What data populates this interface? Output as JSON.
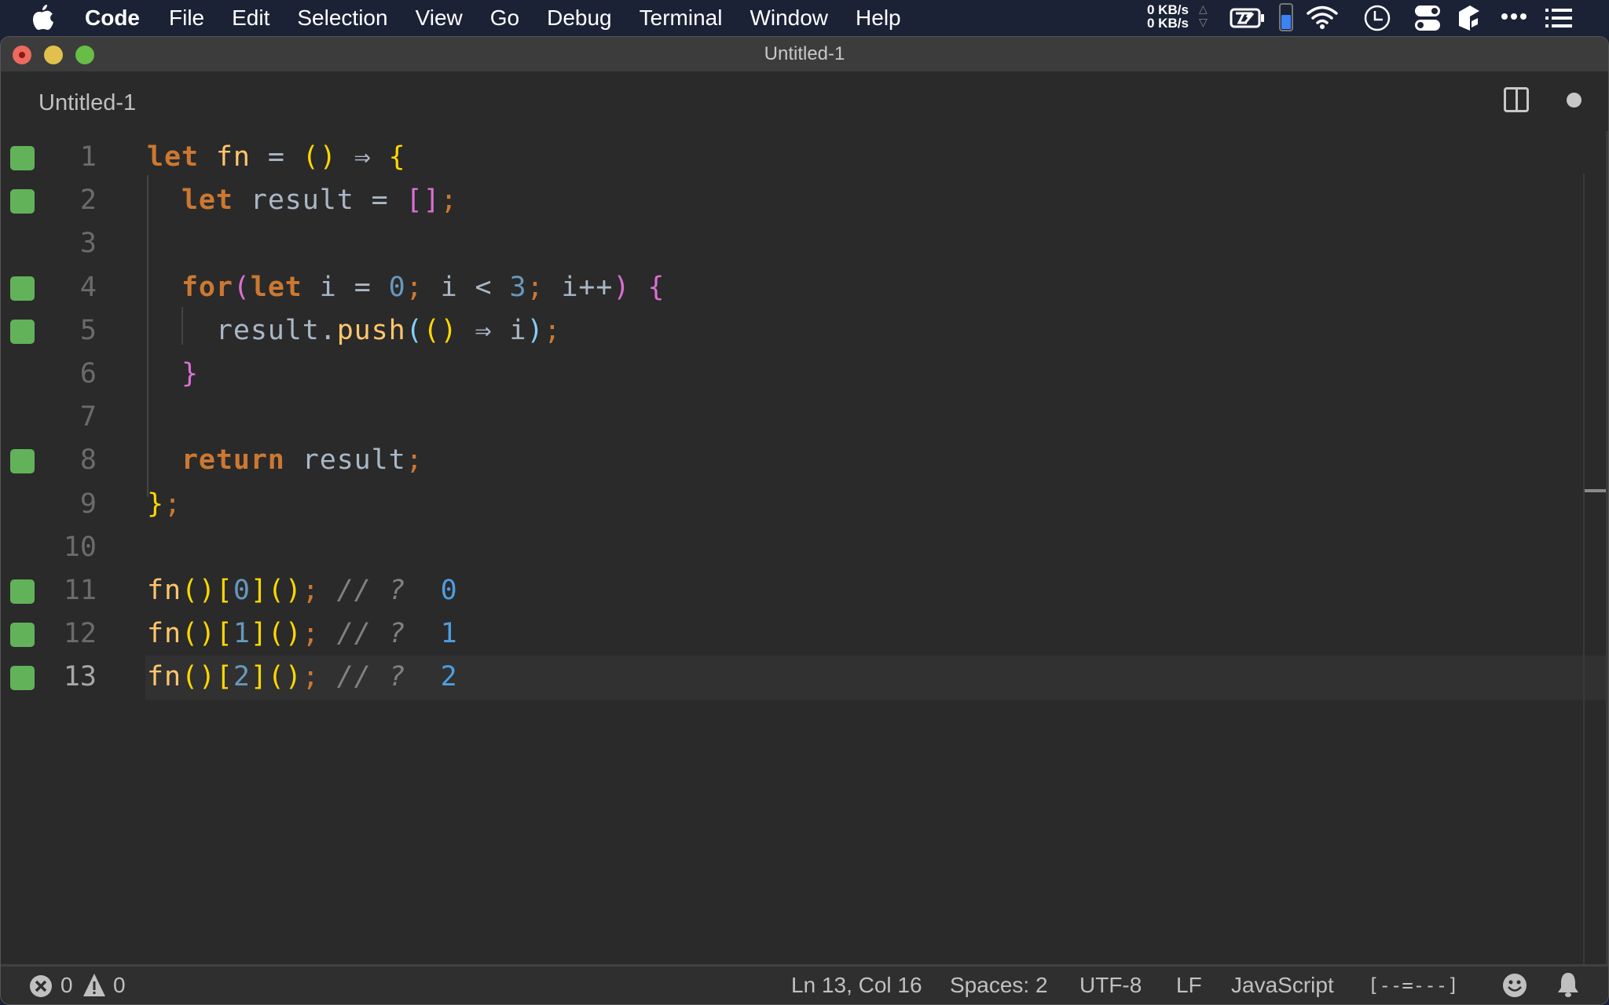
{
  "menubar": {
    "app_name": "Code",
    "menus": [
      "File",
      "Edit",
      "Selection",
      "View",
      "Go",
      "Debug",
      "Terminal",
      "Window",
      "Help"
    ],
    "network": {
      "upload": "0 KB/s",
      "download": "0 KB/s"
    },
    "status_icons": [
      "battery-charging-icon",
      "battery-level-icon",
      "wifi-icon",
      "clock-icon",
      "control-center-icon",
      "box-app-icon",
      "more-icon",
      "list-icon"
    ],
    "battery_level_percent": 60
  },
  "window": {
    "title": "Untitled-1"
  },
  "tab": {
    "title": "Untitled-1",
    "unsaved": true
  },
  "editor": {
    "language": "JavaScript",
    "current_line": 13,
    "lines": [
      {
        "number": "1",
        "marker": true,
        "tokens": [
          [
            "kw",
            "let"
          ],
          [
            "var",
            " "
          ],
          [
            "fnname",
            "fn"
          ],
          [
            "op",
            " = "
          ],
          [
            "p-yellow",
            "()"
          ],
          [
            "arrow",
            " ⇒ "
          ],
          [
            "p-yellow",
            "{"
          ]
        ]
      },
      {
        "number": "2",
        "marker": true,
        "tokens": [
          [
            "var",
            "  "
          ],
          [
            "kw",
            "let"
          ],
          [
            "var",
            " result"
          ],
          [
            "op",
            " = "
          ],
          [
            "p-pink",
            "[]"
          ],
          [
            "semi",
            ";"
          ]
        ]
      },
      {
        "number": "3",
        "marker": false,
        "tokens": []
      },
      {
        "number": "4",
        "marker": true,
        "tokens": [
          [
            "var",
            "  "
          ],
          [
            "kw",
            "for"
          ],
          [
            "p-pink",
            "("
          ],
          [
            "kw",
            "let"
          ],
          [
            "var",
            " i"
          ],
          [
            "op",
            " = "
          ],
          [
            "num",
            "0"
          ],
          [
            "semi",
            ";"
          ],
          [
            "var",
            " i"
          ],
          [
            "op",
            " < "
          ],
          [
            "num",
            "3"
          ],
          [
            "semi",
            ";"
          ],
          [
            "var",
            " i++"
          ],
          [
            "p-pink",
            ")"
          ],
          [
            "var",
            " "
          ],
          [
            "p-pink",
            "{"
          ]
        ]
      },
      {
        "number": "5",
        "marker": true,
        "tokens": [
          [
            "var",
            "    result."
          ],
          [
            "fnname",
            "push"
          ],
          [
            "p-blue",
            "("
          ],
          [
            "p-yellow",
            "()"
          ],
          [
            "arrow",
            " ⇒ "
          ],
          [
            "var",
            "i"
          ],
          [
            "p-blue",
            ")"
          ],
          [
            "semi",
            ";"
          ]
        ]
      },
      {
        "number": "6",
        "marker": false,
        "tokens": [
          [
            "var",
            "  "
          ],
          [
            "p-pink",
            "}"
          ]
        ]
      },
      {
        "number": "7",
        "marker": false,
        "tokens": []
      },
      {
        "number": "8",
        "marker": true,
        "tokens": [
          [
            "var",
            "  "
          ],
          [
            "kw",
            "return"
          ],
          [
            "var",
            " result"
          ],
          [
            "semi",
            ";"
          ]
        ]
      },
      {
        "number": "9",
        "marker": false,
        "tokens": [
          [
            "p-yellow",
            "}"
          ],
          [
            "semi",
            ";"
          ]
        ]
      },
      {
        "number": "10",
        "marker": false,
        "tokens": []
      },
      {
        "number": "11",
        "marker": true,
        "tokens": [
          [
            "fnname",
            "fn"
          ],
          [
            "p-yellow",
            "()["
          ],
          [
            "num",
            "0"
          ],
          [
            "p-yellow",
            "]()"
          ],
          [
            "semi",
            ";"
          ],
          [
            "comment",
            " // ?  "
          ],
          [
            "result",
            "0"
          ]
        ]
      },
      {
        "number": "12",
        "marker": true,
        "tokens": [
          [
            "fnname",
            "fn"
          ],
          [
            "p-yellow",
            "()["
          ],
          [
            "num",
            "1"
          ],
          [
            "p-yellow",
            "]()"
          ],
          [
            "semi",
            ";"
          ],
          [
            "comment",
            " // ?  "
          ],
          [
            "result",
            "1"
          ]
        ]
      },
      {
        "number": "13",
        "marker": true,
        "tokens": [
          [
            "fnname",
            "fn"
          ],
          [
            "p-yellow",
            "()["
          ],
          [
            "num",
            "2"
          ],
          [
            "p-yellow",
            "]()"
          ],
          [
            "semi",
            ";"
          ],
          [
            "comment",
            " // ?  "
          ],
          [
            "result",
            "2"
          ]
        ]
      }
    ],
    "marker_color": "#62b25a"
  },
  "statusbar": {
    "errors": "0",
    "warnings": "0",
    "cursor_position": "Ln 13, Col 16",
    "indentation": "Spaces: 2",
    "encoding": "UTF-8",
    "line_ending": "LF",
    "language_mode": "JavaScript",
    "progress_indicator": "[--=---]"
  }
}
